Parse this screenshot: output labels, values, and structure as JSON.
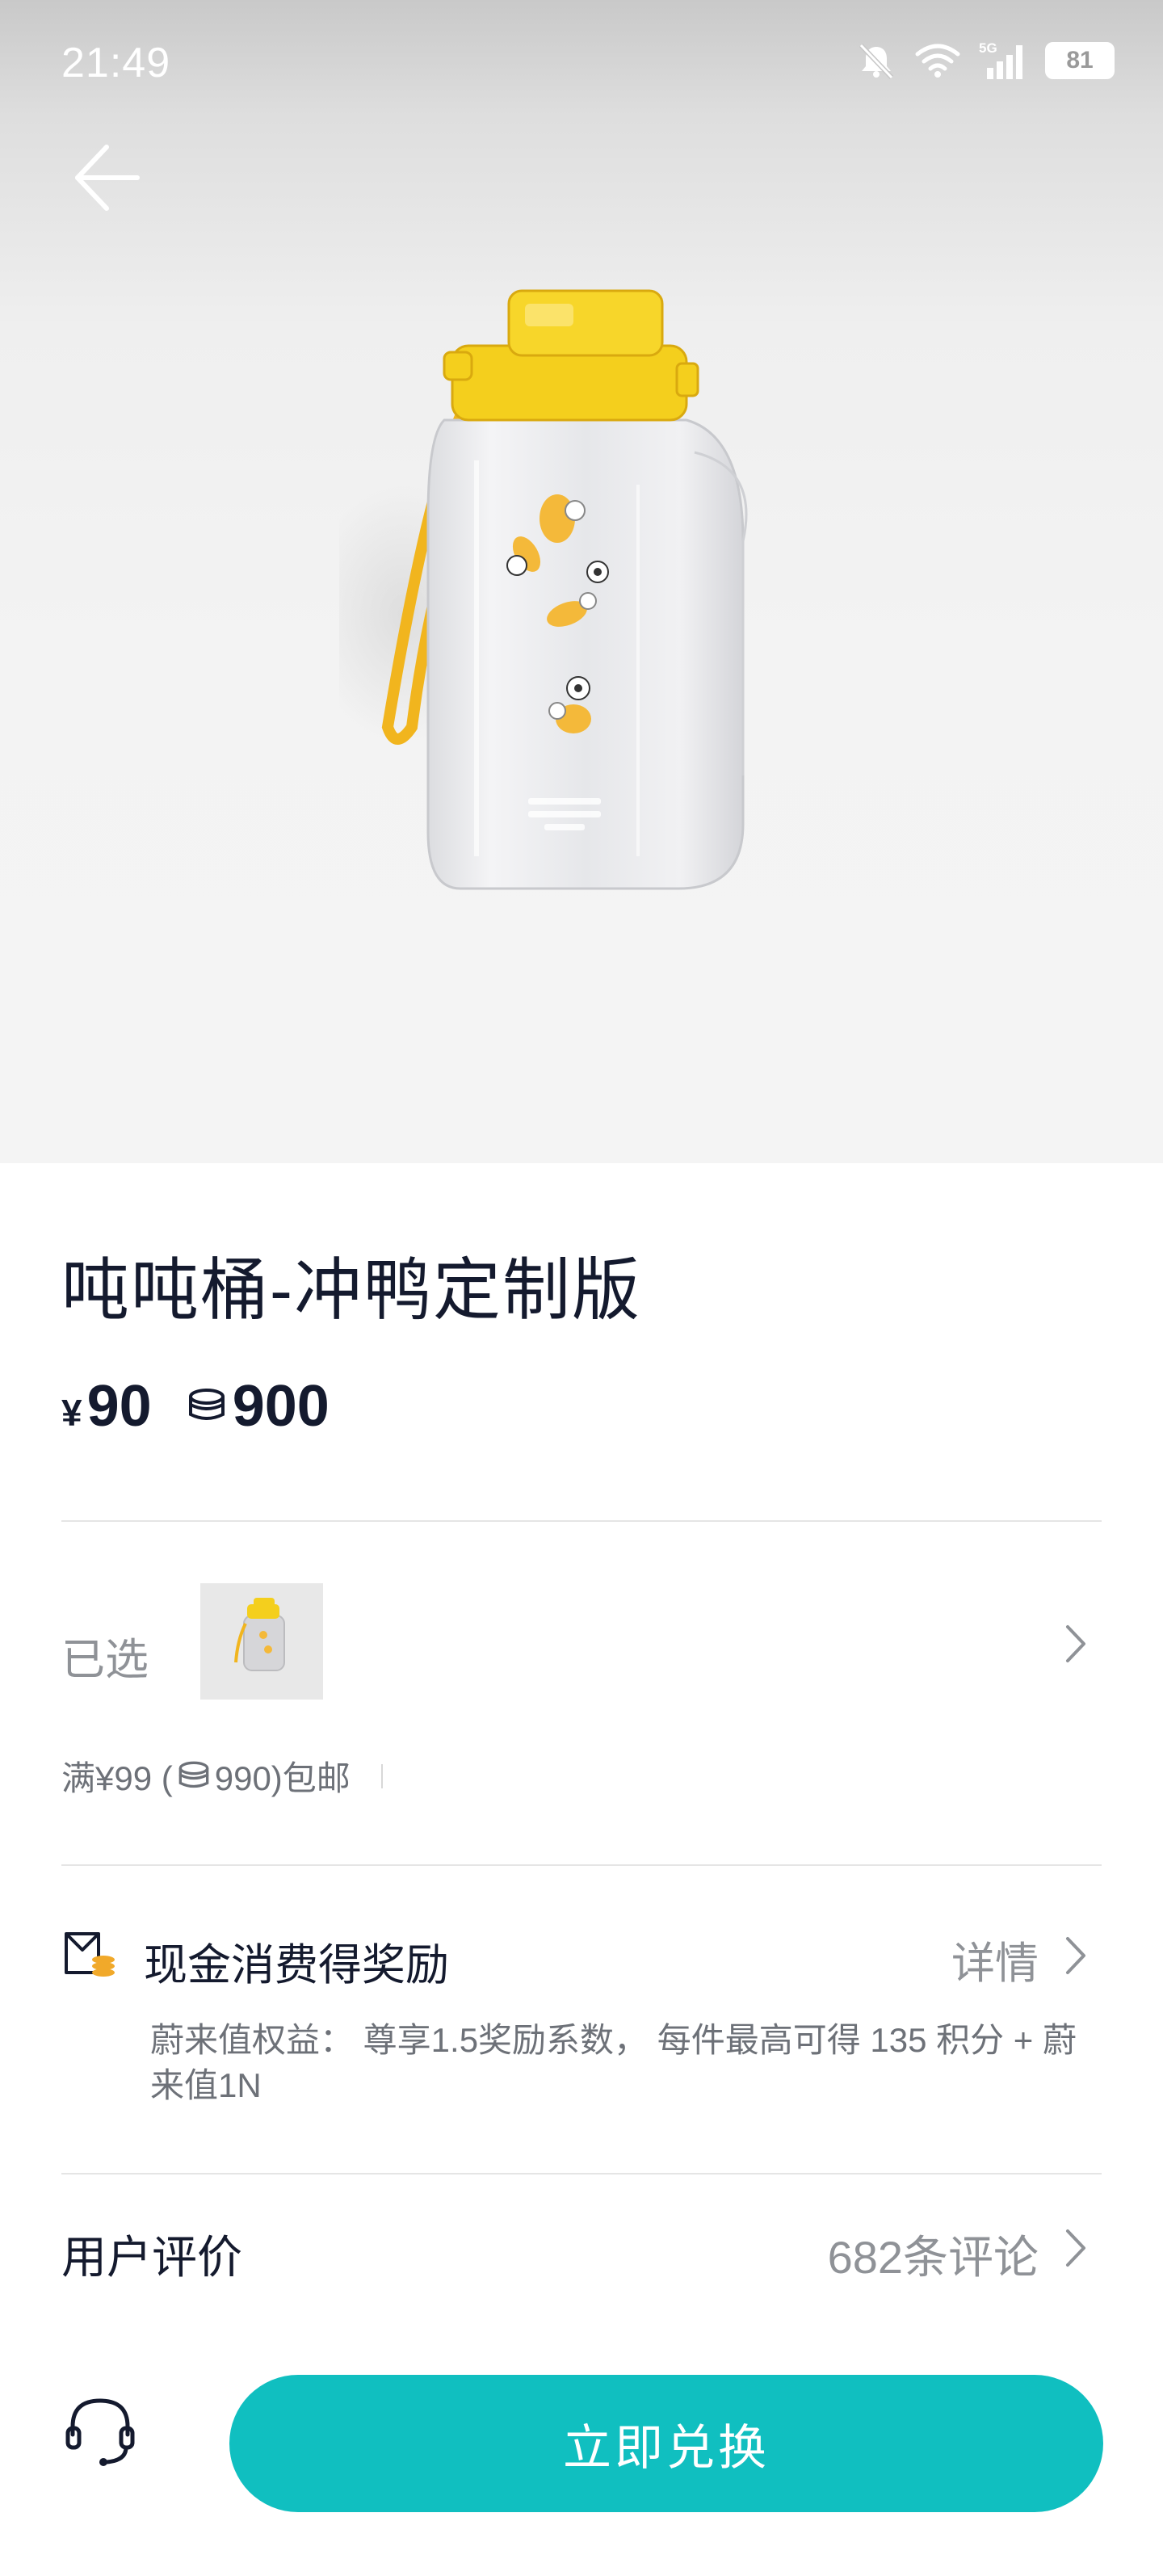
{
  "status_bar": {
    "time": "21:49",
    "network": "5G",
    "battery": "81"
  },
  "product": {
    "title": "吨吨桶-冲鸭定制版",
    "price_symbol": "¥",
    "price": "90",
    "points": "900",
    "selected_label": "已选",
    "shipping": "满¥99 (",
    "shipping_points": "990)包邮"
  },
  "reward": {
    "title": "现金消费得奖励",
    "detail_label": "详情",
    "description": "蔚来值权益： 尊享1.5奖励系数， 每件最高可得 135 积分 + 蔚来值1N"
  },
  "reviews": {
    "title": "用户评价",
    "count_label": "682条评论"
  },
  "actions": {
    "redeem_label": "立即兑换"
  },
  "colors": {
    "accent": "#10BFC0",
    "title_text": "#141A2E",
    "secondary_text": "#8F9297",
    "bottle_cap": "#F2CE1C"
  }
}
